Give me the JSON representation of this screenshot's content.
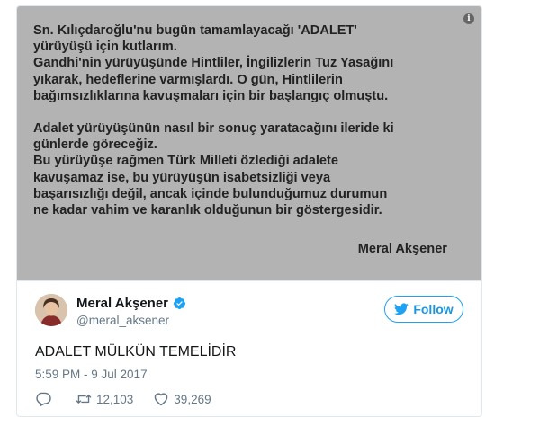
{
  "image": {
    "quote_lines": [
      [
        "Sn. Kılıçdaroğlu'nu bugün tamamlayacağı 'ADALET'",
        "yürüyüşü için kutlarım.",
        "Gandhi'nin yürüyüşünde Hintliler, İngilizlerin Tuz Yasağını",
        "yıkarak, hedeflerine varmışlardı. O gün, Hintlilerin",
        "bağımsızlıklarına kavuşmaları için bir başlangıç olmuştu."
      ],
      [
        "Adalet yürüyüşünün nasıl bir sonuç yaratacağını ileride ki",
        "günlerde göreceğiz.",
        "Bu yürüyüşe rağmen Türk Milleti özlediği adalete",
        "kavuşamaz ise, bu yürüyüşün isabetsizliği veya",
        "başarısızlığı değil, ancak içinde bulunduğumuz durumun",
        "ne kadar vahim ve karanlık olduğunun bir göstergesidir."
      ]
    ],
    "signature": "Meral Akşener",
    "info_icon": "i",
    "background_color": "#b3b3b3"
  },
  "author": {
    "display_name": "Meral Akşener",
    "handle": "@meral_aksener",
    "verified": true
  },
  "follow_label": "Follow",
  "tweet_text": "ADALET MÜLKÜN TEMELİDİR",
  "timestamp": "5:59 PM - 9 Jul 2017",
  "actions": {
    "reply_icon": "reply-icon",
    "retweet_count": "12,103",
    "like_count": "39,269"
  },
  "colors": {
    "accent": "#1da1f2",
    "secondary_text": "#657786"
  }
}
